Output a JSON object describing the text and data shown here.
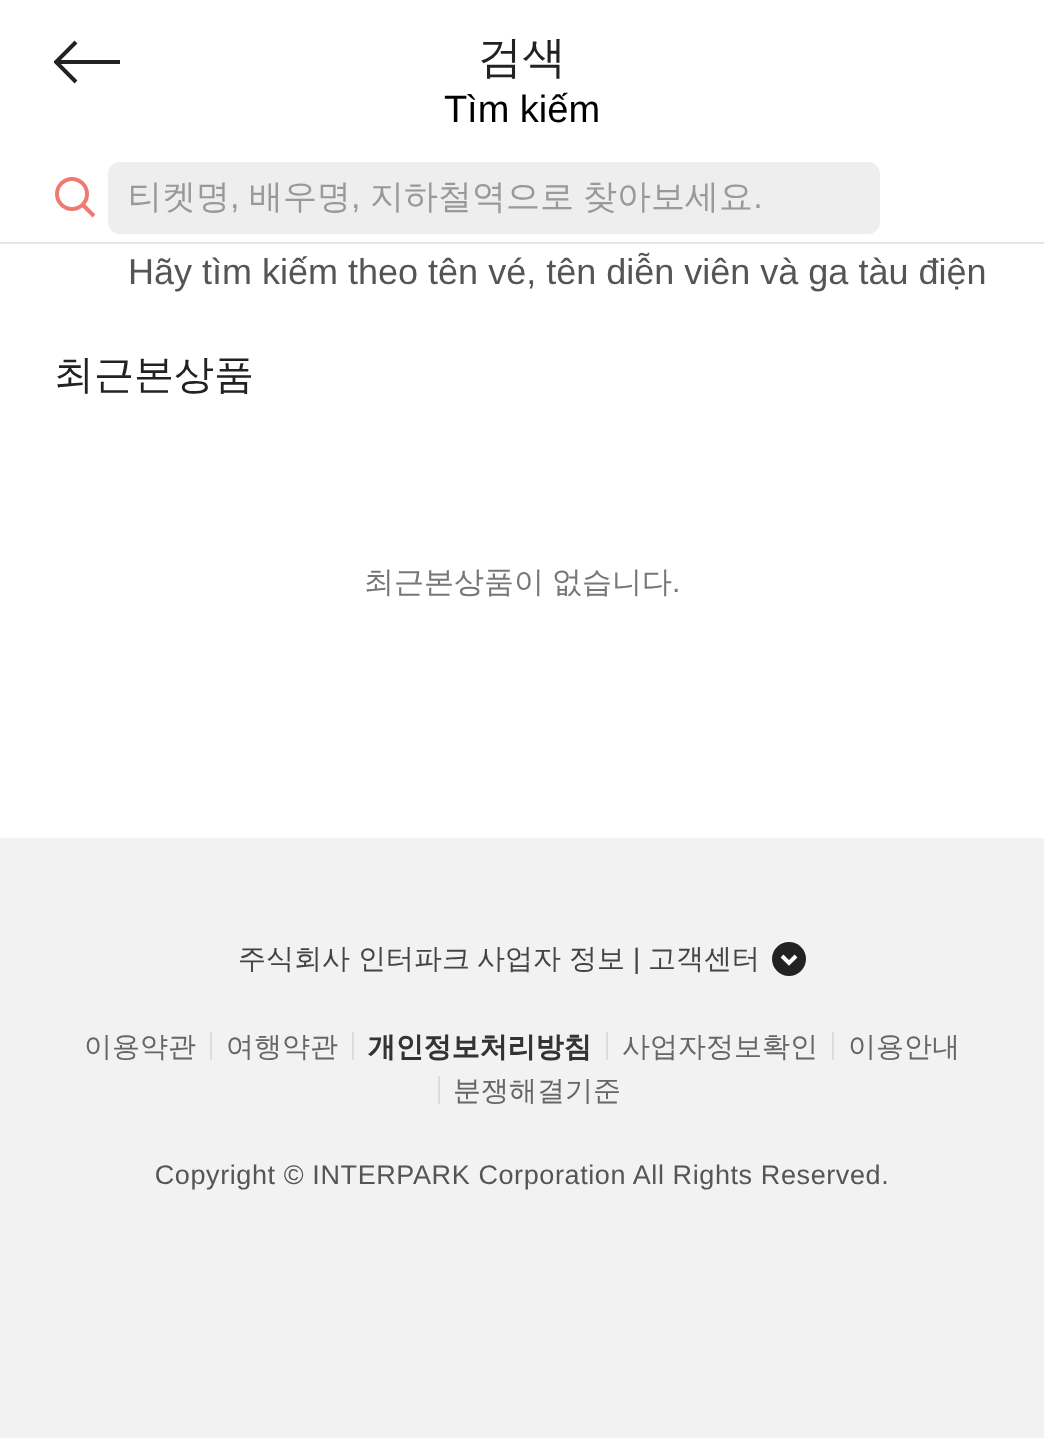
{
  "header": {
    "title": "검색",
    "subtitle": "Tìm kiếm"
  },
  "search": {
    "placeholder": "티켓명, 배우명, 지하철역으로 찾아보세요.",
    "hint": "Hãy tìm kiếm theo tên vé, tên diễn viên và ga tàu điện"
  },
  "recent": {
    "title": "최근본상품",
    "empty_message": "최근본상품이 없습니다."
  },
  "footer": {
    "company_info": "주식회사 인터파크 사업자 정보 | 고객센터",
    "expanded": false,
    "links": [
      {
        "label": "이용약관",
        "emphasized": false
      },
      {
        "label": "여행약관",
        "emphasized": false
      },
      {
        "label": "개인정보처리방침",
        "emphasized": true
      },
      {
        "label": "사업자정보확인",
        "emphasized": false
      },
      {
        "label": "이용안내",
        "emphasized": false
      },
      {
        "label": "분쟁해결기준",
        "emphasized": false
      }
    ],
    "copyright": "Copyright © INTERPARK Corporation All Rights Reserved."
  }
}
